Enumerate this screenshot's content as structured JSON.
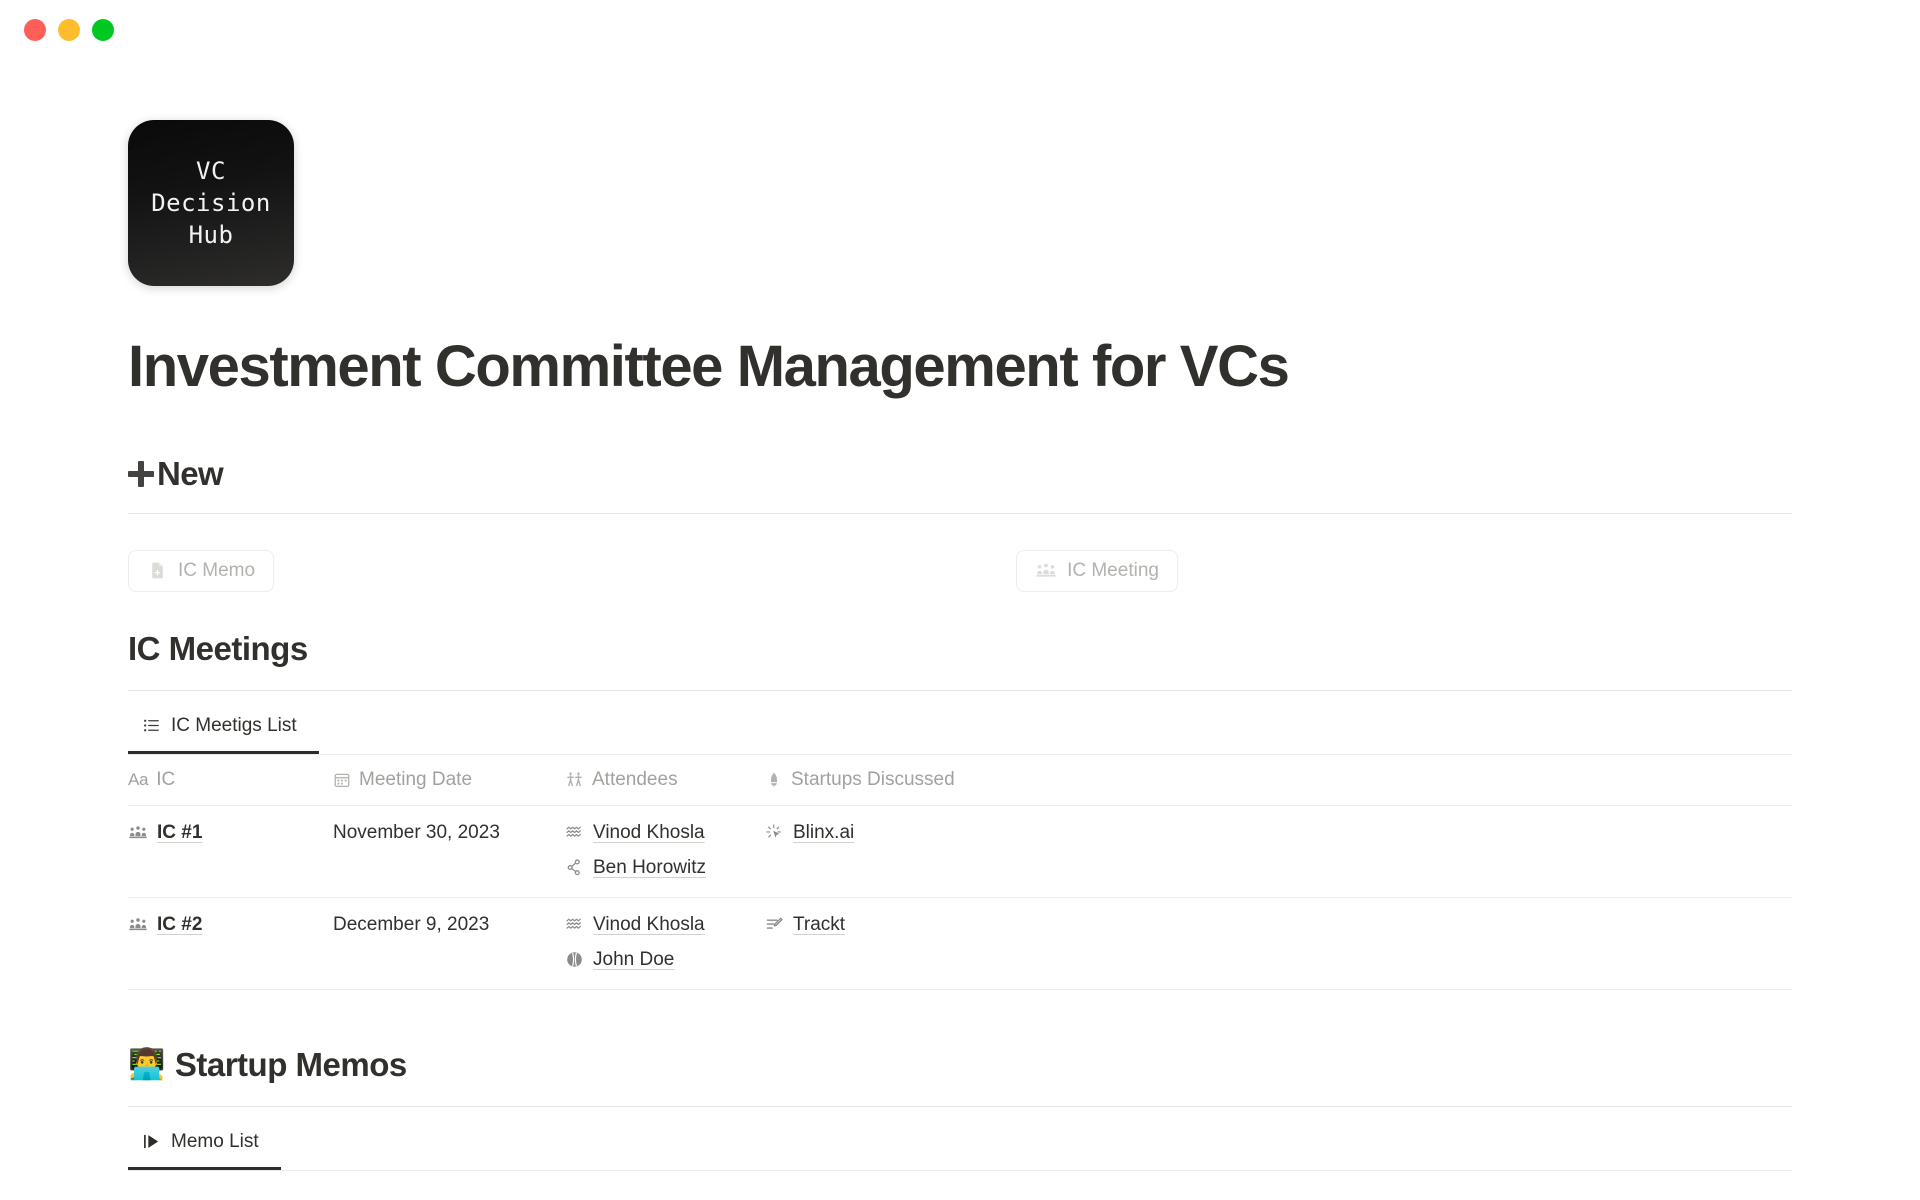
{
  "window": {
    "controls": [
      {
        "name": "close",
        "color": "#ff5f57"
      },
      {
        "name": "minimize",
        "color": "#ffbd2e"
      },
      {
        "name": "maximize",
        "color": "#00c823"
      }
    ]
  },
  "cover": {
    "icon_text": "VC\nDecision\nHub"
  },
  "header": {
    "title": "Investment Committee Management for VCs"
  },
  "new_section": {
    "heading": "New",
    "buttons": [
      {
        "label": "IC Memo",
        "icon": "document-plus-icon"
      },
      {
        "label": "IC Meeting",
        "icon": "meeting-people-icon"
      }
    ]
  },
  "meetings_section": {
    "heading": "IC Meetings",
    "tabs": [
      {
        "label": "IC Meetigs List",
        "icon": "list-icon",
        "active": true
      }
    ],
    "columns": [
      {
        "label": "IC",
        "icon": "aa-text-icon"
      },
      {
        "label": "Meeting Date",
        "icon": "calendar-icon"
      },
      {
        "label": "Attendees",
        "icon": "people-icon"
      },
      {
        "label": "Startups Discussed",
        "icon": "rocket-icon"
      }
    ],
    "rows": [
      {
        "ic": {
          "label": "IC #1",
          "icon": "meeting-people-icon"
        },
        "date": "November 30, 2023",
        "attendees": [
          {
            "label": "Vinod Khosla",
            "icon": "waves-icon"
          },
          {
            "label": "Ben Horowitz",
            "icon": "node-graph-icon"
          }
        ],
        "startups": [
          {
            "label": "Blinx.ai",
            "icon": "cursor-sparkle-icon"
          }
        ]
      },
      {
        "ic": {
          "label": "IC #2",
          "icon": "meeting-people-icon"
        },
        "date": "December 9, 2023",
        "attendees": [
          {
            "label": "Vinod Khosla",
            "icon": "waves-icon"
          },
          {
            "label": "John Doe",
            "icon": "circle-ball-icon"
          }
        ],
        "startups": [
          {
            "label": "Trackt",
            "icon": "edit-list-icon"
          }
        ]
      }
    ]
  },
  "memos_section": {
    "emoji": "👨‍💻",
    "heading": "Startup Memos",
    "tabs": [
      {
        "label": "Memo List",
        "icon": "play-gallery-icon",
        "active": true
      }
    ]
  }
}
